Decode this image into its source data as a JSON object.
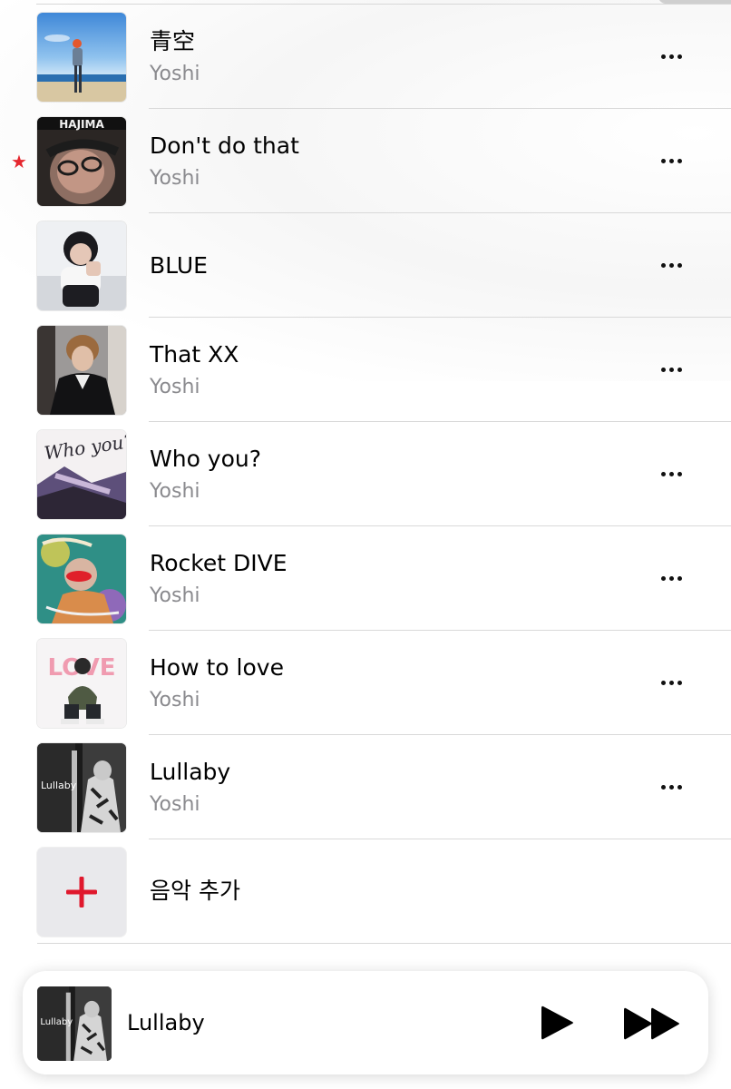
{
  "tracks": [
    {
      "title": "青空",
      "artist": "Yoshi",
      "art": "beach-cover-art",
      "starred": false
    },
    {
      "title": "Don't do that",
      "artist": "Yoshi",
      "art": "hajima-cover-art",
      "starred": true,
      "art_text": "HAJIMA"
    },
    {
      "title": "BLUE",
      "artist": "",
      "art": "blue-cover-art",
      "starred": false
    },
    {
      "title": "That XX",
      "artist": "Yoshi",
      "art": "that-xx-cover-art",
      "starred": false
    },
    {
      "title": "Who you?",
      "artist": "Yoshi",
      "art": "who-you-cover-art",
      "starred": false,
      "art_text": "Who you?"
    },
    {
      "title": "Rocket DIVE",
      "artist": "Yoshi",
      "art": "rocket-dive-cover-art",
      "starred": false
    },
    {
      "title": "How to love",
      "artist": "Yoshi",
      "art": "how-to-love-cover-art",
      "starred": false,
      "art_text": "LOVE"
    },
    {
      "title": "Lullaby",
      "artist": "Yoshi",
      "art": "lullaby-cover-art",
      "starred": false,
      "art_text": "Lullaby"
    }
  ],
  "add_music": {
    "label": "음악 추가",
    "icon": "plus-icon",
    "icon_color": "#e0182d"
  },
  "star_icon": {
    "glyph": "★",
    "color": "#e5262e"
  },
  "more_icon": "ellipsis-icon",
  "mini_player": {
    "title": "Lullaby",
    "art_text": "Lullaby",
    "play_icon": "play-icon",
    "forward_icon": "fast-forward-icon"
  }
}
